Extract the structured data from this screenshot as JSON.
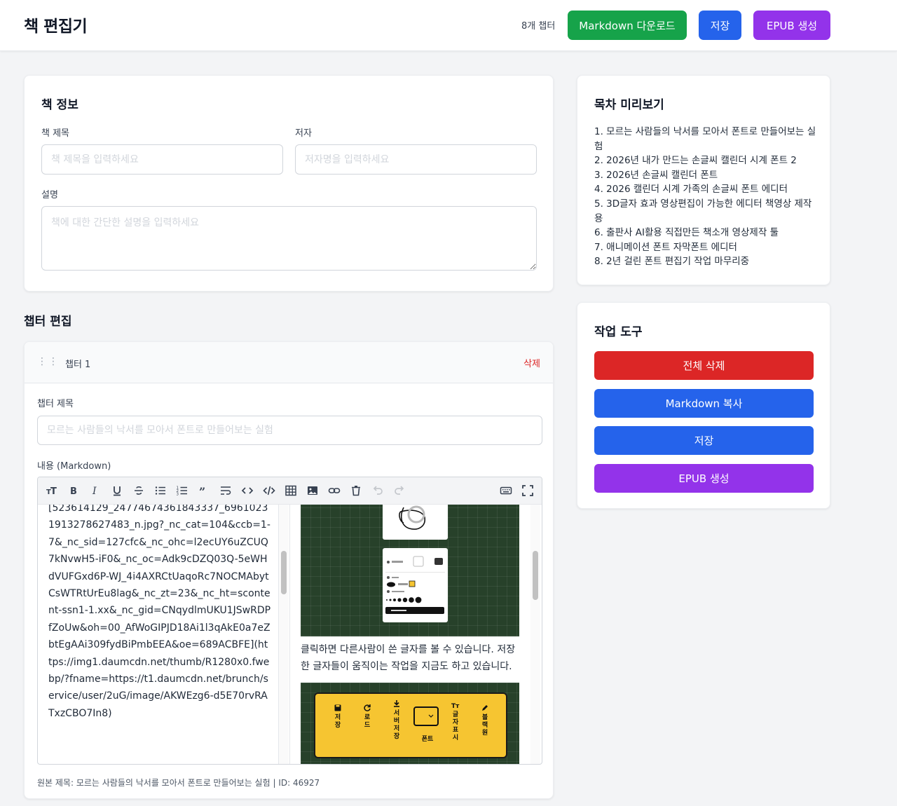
{
  "header": {
    "title": "책 편집기",
    "chapter_count": "8개 챕터",
    "download_md_label": "Markdown 다운로드",
    "save_label": "저장",
    "epub_label": "EPUB 생성"
  },
  "book_info": {
    "title": "책 정보",
    "book_title_label": "책 제목",
    "book_title_placeholder": "책 제목을 입력하세요",
    "author_label": "저자",
    "author_placeholder": "저자명을 입력하세요",
    "description_label": "설명",
    "description_placeholder": "책에 대한 간단한 설명을 입력하세요"
  },
  "chapter_edit": {
    "section_title": "챕터 편집",
    "chapter_name": "챕터 1",
    "delete_label": "삭제",
    "chapter_title_label": "챕터 제목",
    "chapter_title_placeholder": "모르는 사람들의 낙서를 모아서 폰트로 만들어보는 실험",
    "content_label": "내용 (Markdown)",
    "markdown_text": "[523614129_24774674361843337_69610231913278627483_n.jpg?_nc_cat=104&ccb=1-7&_nc_sid=127cfc&_nc_ohc=l2ecUY6uZCUQ7kNvwH5-iF0&_nc_oc=Adk9cDZQ03Q-5eWHdVUFGxd6P-WJ_4i4AXRCtUaqoRc7NOCMAbytCsWTRtUrEu8lag&_nc_zt=23&_nc_ht=scontent-ssn1-1.xx&_nc_gid=CNqydlmUKU1JSwRDPfZoUw&oh=00_AfWoGIPJD18Ai1l3qAkE0a7eZbtEgAAi309fydBiPmbEEA&oe=689ACBFE](https://img1.daumcdn.net/thumb/R1280x0.fwebp/?fname=https://t1.daumcdn.net/brunch/service/user/2uG/image/AKWEzg6-d5E70rvRATxzCBO7In8)",
    "preview_text": "클릭하면 다른사람이 쓴 글자를 볼 수 있습니다. 저장한 글자들이 움직이는 작업을 지금도 하고 있습니다.",
    "preview_toolbar": {
      "save": "저장",
      "load": "로드",
      "server_save": "서버저장",
      "font": "폰트",
      "show_text": "글자표시",
      "blackboard": "블랙원"
    },
    "footnote": "원본 제목: 모르는 사람들의 낙서를 모아서 폰트로 만들어보는 실험 | ID: 46927"
  },
  "toc": {
    "title": "목차 미리보기",
    "items": [
      "1. 모르는 사람들의 낙서를 모아서 폰트로 만들어보는 실험",
      "2. 2026년 내가 만드는 손글씨 캘린더 시계 폰트 2",
      "3. 2026년 손글씨 캘린더 폰트",
      "4. 2026 캘린더 시계 가족의 손글씨 폰트 에디터",
      "5. 3D글자 효과 영상편집이 가능한 에디터 책영상 제작용",
      "6. 출판사 AI활용 직접만든 책소개 영상제작 툴",
      "7. 애니메이션 폰트 자막폰트 에디터",
      "8. 2년 걸린 폰트 편집기 작업 마무리중"
    ]
  },
  "tools": {
    "title": "작업 도구",
    "delete_all": "전체 삭제",
    "copy_md": "Markdown 복사",
    "save": "저장",
    "epub": "EPUB 생성"
  },
  "colors": {
    "green": "#16a34a",
    "blue": "#2563eb",
    "purple": "#9333ea",
    "red": "#dc2626"
  }
}
